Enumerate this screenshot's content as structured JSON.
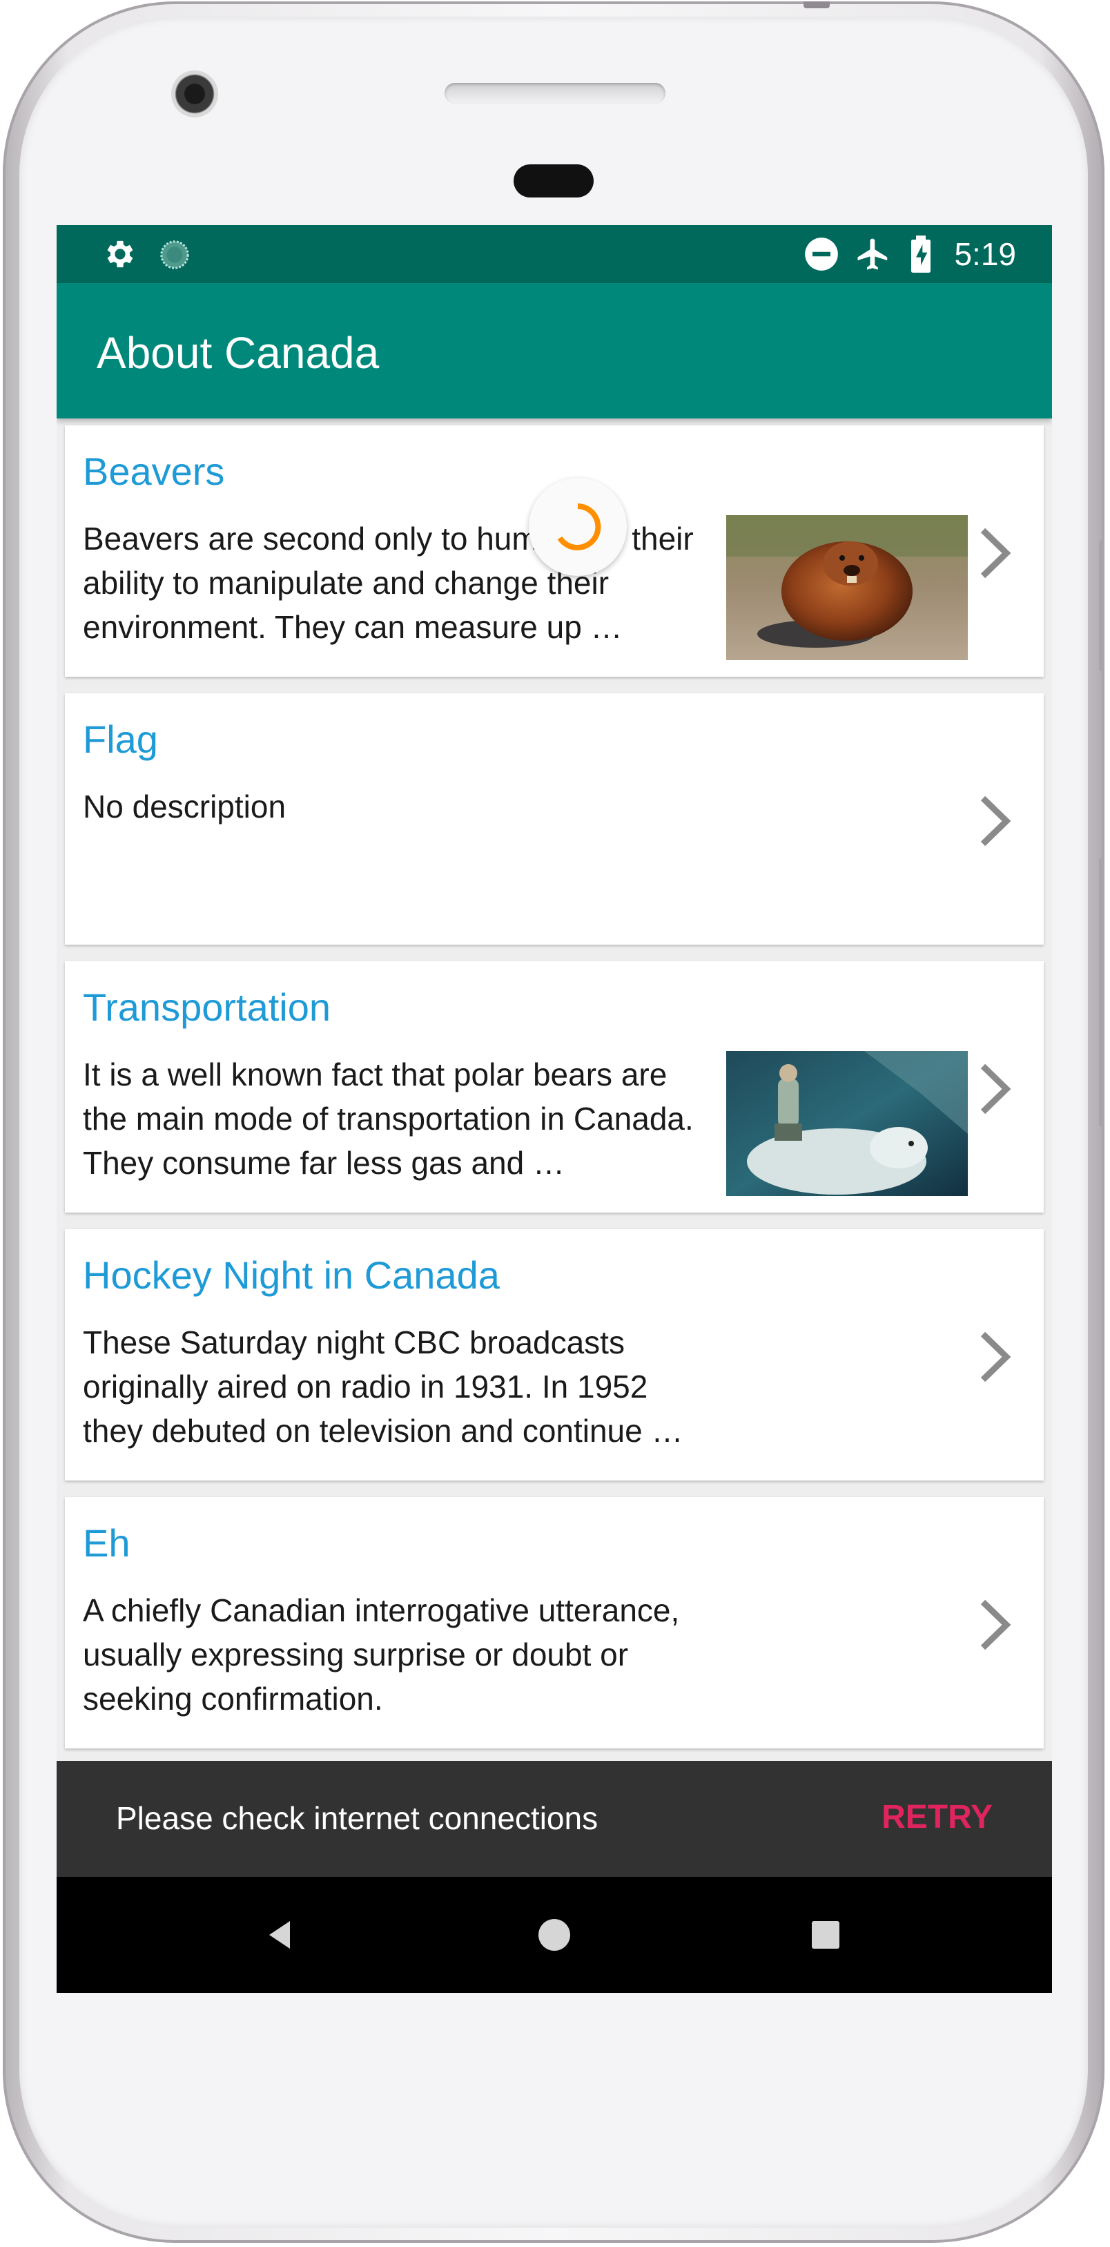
{
  "status_bar": {
    "time": "5:19",
    "left_icons": [
      "gear-icon",
      "sync-icon"
    ],
    "right_icons": [
      "do-not-disturb-icon",
      "airplane-mode-icon",
      "battery-charging-icon"
    ]
  },
  "app_bar": {
    "title": "About Canada"
  },
  "items": [
    {
      "title": "Beavers",
      "description": "Beavers are second only to humans in their ability to manipulate and change their environment. They can measure up …",
      "has_image": true,
      "image": "beaver-photo"
    },
    {
      "title": "Flag",
      "description": "No description",
      "has_image": false
    },
    {
      "title": "Transportation",
      "description": "It is a well known fact that polar bears are the main mode of transportation in Canada. They consume far less gas and …",
      "has_image": true,
      "image": "polar-bear-rider-photo"
    },
    {
      "title": "Hockey Night in Canada",
      "description": "These Saturday night CBC broadcasts originally aired on radio in 1931. In 1952 they debuted on television and continue …",
      "has_image": false
    },
    {
      "title": "Eh",
      "description": "A chiefly Canadian interrogative utterance, usually expressing surprise or doubt or seeking confirmation.",
      "has_image": false
    }
  ],
  "snackbar": {
    "message": "Please check internet connections",
    "action": "RETRY"
  },
  "navigation": {
    "buttons": [
      "back-icon",
      "home-icon",
      "recents-icon"
    ]
  },
  "colors": {
    "status_bar": "#00695c",
    "app_bar": "#00897b",
    "item_title": "#1e9ad6",
    "snackbar_action": "#e0245e",
    "spinner": "#ff8f00"
  }
}
